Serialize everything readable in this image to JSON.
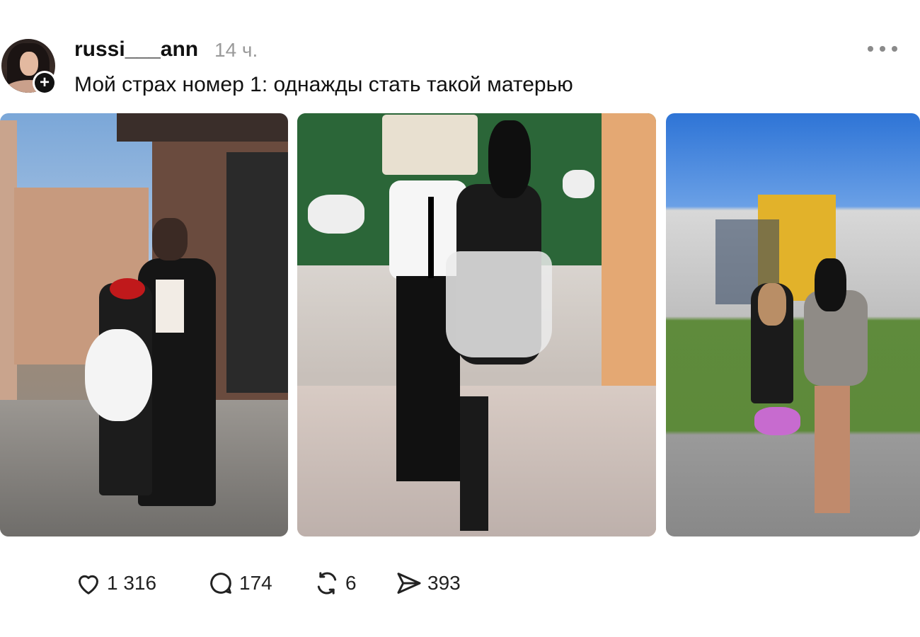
{
  "post": {
    "username": "russi___ann",
    "time": "14 ч.",
    "text": "Мой страх номер 1: однажды стать такой матерью",
    "follow_symbol": "+"
  },
  "photos": [
    {
      "icon": "photo-mother-daughter-street"
    },
    {
      "icon": "photo-mother-son-classroom"
    },
    {
      "icon": "photo-mother-daughter-school-yard"
    }
  ],
  "actions": {
    "likes": "1 316",
    "comments": "174",
    "reposts": "6",
    "shares": "393"
  },
  "colors": {
    "text": "#111111",
    "muted": "#9a9a9a",
    "icon": "#222222"
  }
}
